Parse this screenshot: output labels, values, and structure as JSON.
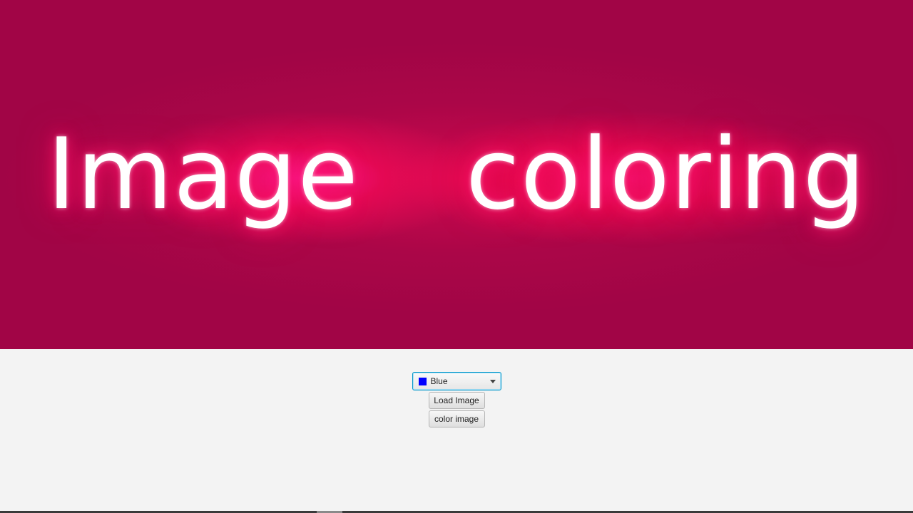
{
  "image_view": {
    "text": "Image  coloring",
    "background_color": "#a10546",
    "glow_color": "#ff1470",
    "text_color": "#ffffff"
  },
  "controls": {
    "color_select": {
      "selected_label": "Blue",
      "selected_color": "#0000ff",
      "icon": "chevron-down-icon"
    },
    "load_image_label": "Load Image",
    "color_image_label": "color image"
  }
}
